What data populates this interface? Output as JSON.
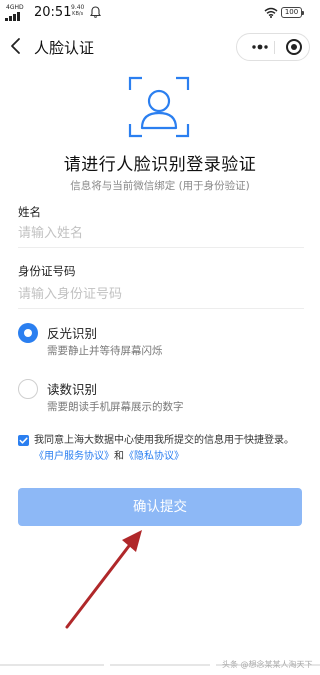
{
  "status_bar": {
    "network": "4G",
    "network_sub": "HD",
    "time": "20:51",
    "speed_value": "9.40",
    "speed_unit": "KB/s",
    "battery": "100"
  },
  "header": {
    "title": "人脸认证"
  },
  "colors": {
    "accent": "#2b7ff0",
    "button_disabled": "#8db8f6",
    "arrow": "#b0282a"
  },
  "hero": {
    "icon": "face-scan-icon",
    "title": "请进行人脸识别登录验证",
    "subtitle": "信息将与当前微信绑定 (用于身份验证)"
  },
  "form": {
    "name_label": "姓名",
    "name_value": "",
    "name_placeholder": "请输入姓名",
    "id_label": "身份证号码",
    "id_value": "",
    "id_placeholder": "请输入身份证号码"
  },
  "methods": [
    {
      "title": "反光识别",
      "desc": "需要静止并等待屏幕闪烁",
      "selected": true
    },
    {
      "title": "读数识别",
      "desc": "需要朗读手机屏幕展示的数字",
      "selected": false
    }
  ],
  "agreement": {
    "checked": true,
    "text": "我同意上海大数据中心使用我所提交的信息用于快捷登录。",
    "link1": "《用户服务协议》",
    "and": "和",
    "link2": "《隐私协议》"
  },
  "submit_label": "确认提交",
  "watermark": "头条 @想念某某人淘天下"
}
